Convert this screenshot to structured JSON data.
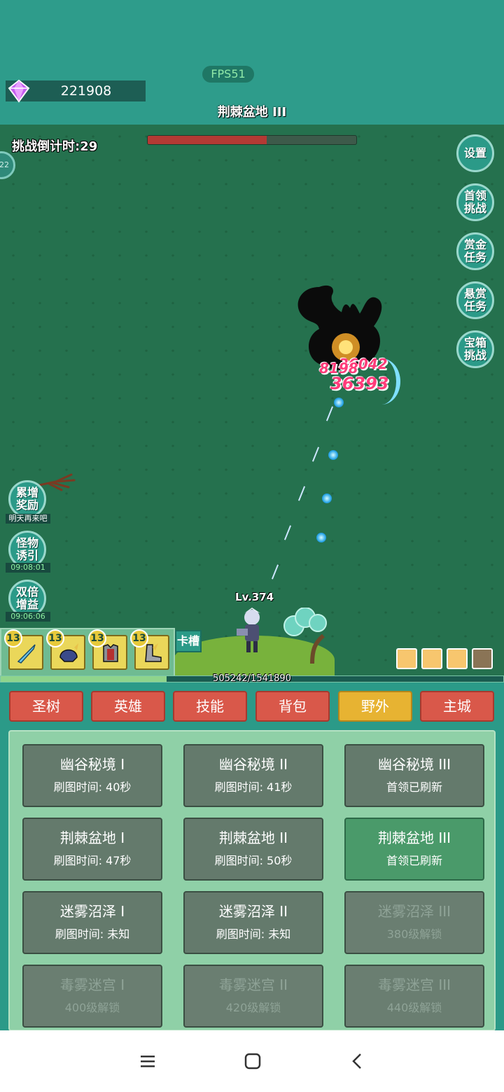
{
  "top": {
    "fps": "FPS51",
    "gems": "221908",
    "stage_title": "荆棘盆地 III"
  },
  "battle": {
    "countdown": "挑战倒计时:29",
    "boss_hp_fraction": 0.57,
    "orb_label": "22",
    "damage_numbers": [
      "36042",
      "8198",
      "36393"
    ],
    "player_level": "Lv.374",
    "xp_text": "505242/1541890",
    "xp_fraction": 0.33
  },
  "side_buttons": [
    {
      "label_1": "设置",
      "label_2": ""
    },
    {
      "label_1": "首领",
      "label_2": "挑战"
    },
    {
      "label_1": "赏金",
      "label_2": "任务"
    },
    {
      "label_1": "悬赏",
      "label_2": "任务"
    },
    {
      "label_1": "宝箱",
      "label_2": "挑战"
    }
  ],
  "left_buttons": [
    {
      "label_1": "累增",
      "label_2": "奖励",
      "sub": "明天再来吧"
    },
    {
      "label_1": "怪物",
      "label_2": "诱引",
      "sub": "09:08:01"
    },
    {
      "label_1": "双倍",
      "label_2": "增益",
      "sub": "09:06:06"
    }
  ],
  "cards": [
    {
      "level": "13",
      "icon": "sword-icon"
    },
    {
      "level": "13",
      "icon": "helmet-icon"
    },
    {
      "level": "13",
      "icon": "armor-icon"
    },
    {
      "level": "13",
      "icon": "boots-icon"
    }
  ],
  "card_slot_label": "卡槽",
  "tabs": [
    "圣树",
    "英雄",
    "技能",
    "背包",
    "野外",
    "主城"
  ],
  "active_tab": "野外",
  "maps": [
    {
      "name": "幽谷秘境 I",
      "sub": "刷图时间: 40秒",
      "state": "normal"
    },
    {
      "name": "幽谷秘境 II",
      "sub": "刷图时间: 41秒",
      "state": "normal"
    },
    {
      "name": "幽谷秘境 III",
      "sub": "首领已刷新",
      "state": "normal"
    },
    {
      "name": "荆棘盆地 I",
      "sub": "刷图时间: 47秒",
      "state": "normal"
    },
    {
      "name": "荆棘盆地 II",
      "sub": "刷图时间: 50秒",
      "state": "normal"
    },
    {
      "name": "荆棘盆地 III",
      "sub": "首领已刷新",
      "state": "current"
    },
    {
      "name": "迷雾沼泽 I",
      "sub": "刷图时间: 未知",
      "state": "normal"
    },
    {
      "name": "迷雾沼泽 II",
      "sub": "刷图时间: 未知",
      "state": "normal"
    },
    {
      "name": "迷雾沼泽 III",
      "sub": "380级解锁",
      "state": "locked"
    },
    {
      "name": "毒雾迷宫 I",
      "sub": "400级解锁",
      "state": "locked"
    },
    {
      "name": "毒雾迷宫 II",
      "sub": "420级解锁",
      "state": "locked"
    },
    {
      "name": "毒雾迷宫 III",
      "sub": "440级解锁",
      "state": "locked"
    }
  ],
  "colors": {
    "teal_bg": "#2b9a88",
    "grass": "#25714e",
    "tab_red": "#d9584a",
    "tab_active": "#e7b332",
    "map_button": "#647a6c",
    "map_current": "#4a9a6a"
  }
}
